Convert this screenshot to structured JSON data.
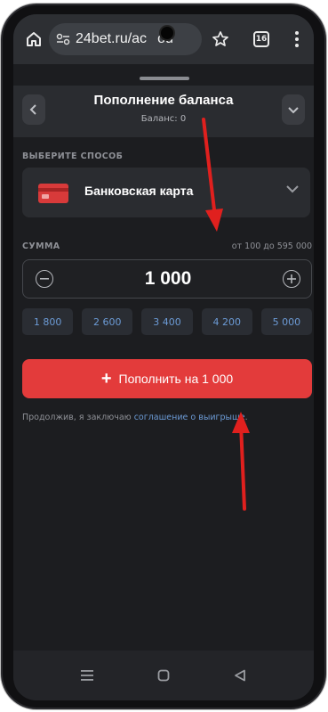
{
  "browser": {
    "url": "24bet.ru/ac",
    "url_tail": "ou",
    "tab_count": "16",
    "icons": [
      "home-icon",
      "site-settings-icon",
      "star-icon",
      "tabs-icon",
      "more-vert-icon"
    ]
  },
  "sheet": {
    "title": "Пополнение баланса",
    "balance": "Баланс: 0",
    "method_section_label": "ВЫБЕРИТЕ СПОСОБ",
    "method_label": "Банковская карта",
    "amount_section_label": "СУММА",
    "amount_range": "от 100 до 595 000",
    "amount_value": "1 000",
    "presets": [
      "1 800",
      "2 600",
      "3 400",
      "4 200",
      "5 000"
    ],
    "cta_label": "Пополнить на 1 000",
    "terms_prefix": "Продолжив, я заключаю ",
    "terms_link": "соглашение о выигрыше",
    "terms_suffix": "."
  },
  "colors": {
    "accent": "#e33b3b",
    "link": "#6c9bd6",
    "background": "#1c1d20",
    "annotation_arrow": "#e0201e"
  },
  "system_nav": {
    "icons": [
      "recent-apps-icon",
      "home-circle-icon",
      "back-triangle-icon"
    ]
  }
}
